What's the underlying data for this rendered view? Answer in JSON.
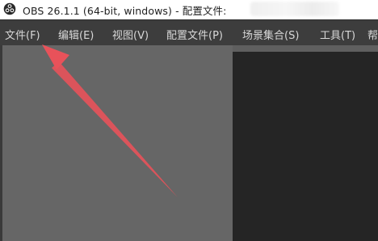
{
  "window": {
    "title": "OBS 26.1.1 (64-bit, windows) - 配置文件:",
    "icon": "obs-logo-icon"
  },
  "menu": {
    "items": [
      {
        "label": "文件(F)"
      },
      {
        "label": "编辑(E)"
      },
      {
        "label": "视图(V)"
      },
      {
        "label": "配置文件(P)"
      },
      {
        "label": "场景集合(S)"
      },
      {
        "label": "工具(T)"
      },
      {
        "label": "帮"
      }
    ]
  },
  "colors": {
    "menubar_bg": "#3d3d3d",
    "preview_gray": "#666666",
    "preview_dark": "#252525",
    "annotation_arrow": "#e8525a"
  }
}
